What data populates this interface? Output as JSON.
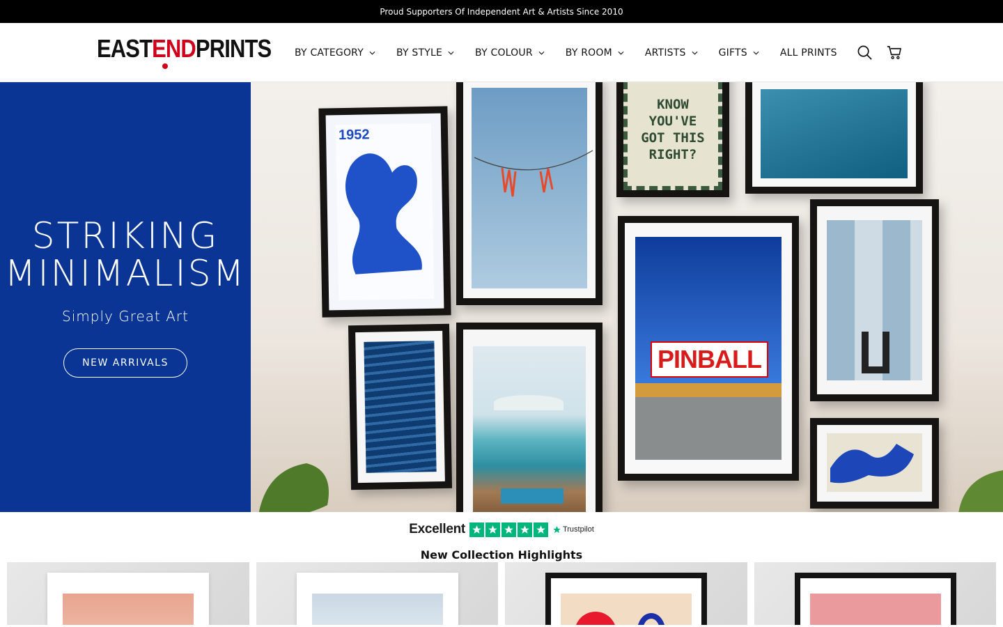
{
  "announcement": "Proud Supporters Of Independent Art & Artists Since 2010",
  "logo": {
    "part1": "EAST",
    "part2": "END",
    "part3": "PRINTS"
  },
  "nav": [
    {
      "label": "BY CATEGORY",
      "dropdown": true
    },
    {
      "label": "BY STYLE",
      "dropdown": true
    },
    {
      "label": "BY COLOUR",
      "dropdown": true
    },
    {
      "label": "BY ROOM",
      "dropdown": true
    },
    {
      "label": "ARTISTS",
      "dropdown": true
    },
    {
      "label": "GIFTS",
      "dropdown": true
    },
    {
      "label": "ALL PRINTS",
      "dropdown": false
    }
  ],
  "header_icons": [
    "search-icon",
    "cart-icon"
  ],
  "hero": {
    "title_line1": "STRIKING",
    "title_line2": "MINIMALISM",
    "subtitle": "Simply Great Art",
    "button": "NEW ARRIVALS",
    "poster_year": "1952",
    "poster_text": "KNOW YOU'VE GOT THIS RIGHT?",
    "pinball_sign": "PINBALL"
  },
  "trustpilot": {
    "rating_word": "Excellent",
    "stars": 5,
    "brand": "Trustpilot"
  },
  "section_title": "New Collection Highlights",
  "colors": {
    "hero_blue": "#0a3594",
    "brand_red": "#d0021b",
    "trust_green": "#00b67a"
  }
}
